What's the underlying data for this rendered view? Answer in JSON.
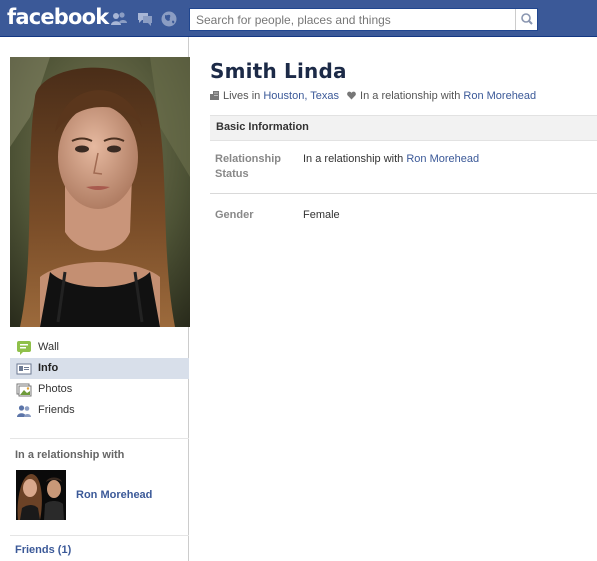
{
  "topbar": {
    "logo": "facebook",
    "search_placeholder": "Search for people, places and things",
    "icons": [
      "friend-requests-icon",
      "messages-icon",
      "notifications-globe-icon",
      "magnifier-icon"
    ],
    "brand_color": "#3b5998"
  },
  "profile": {
    "name": "Smith Linda",
    "lives_in_prefix": "Lives in",
    "location": "Houston, Texas",
    "relationship_prefix": "In a relationship with",
    "partner": "Ron Morehead"
  },
  "nav": {
    "items": [
      {
        "label": "Wall",
        "icon": "wall-icon"
      },
      {
        "label": "Info",
        "icon": "info-card-icon",
        "active": true
      },
      {
        "label": "Photos",
        "icon": "photos-icon"
      },
      {
        "label": "Friends",
        "icon": "friends-icon"
      }
    ]
  },
  "sidebar": {
    "relationship_heading": "In a relationship with",
    "partner_name": "Ron Morehead",
    "friends_link": "Friends (1)"
  },
  "basic_info": {
    "heading": "Basic Information",
    "relationship_label_line1": "Relationship",
    "relationship_label_line2": "Status",
    "relationship_value_prefix": "In a relationship with",
    "relationship_value_link": "Ron Morehead",
    "gender_label": "Gender",
    "gender_value": "Female"
  }
}
